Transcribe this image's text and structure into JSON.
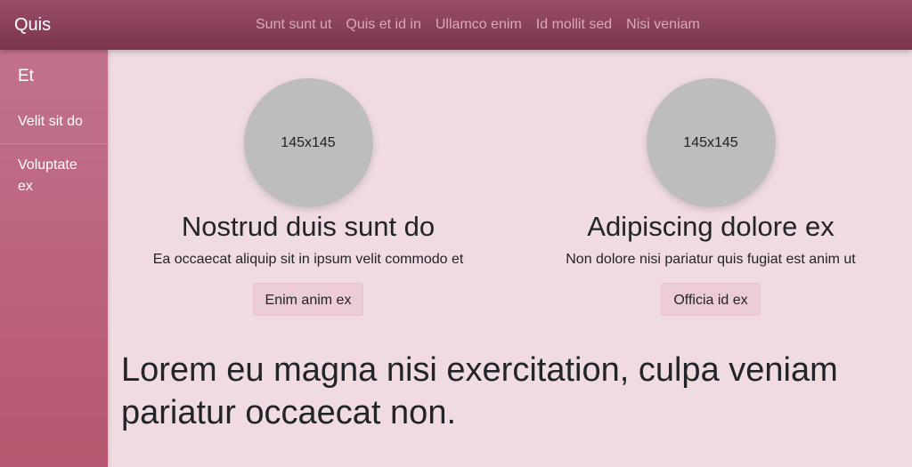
{
  "topbar": {
    "brand": "Quis",
    "nav": [
      "Sunt sunt ut",
      "Quis et id in",
      "Ullamco enim",
      "Id mollit sed",
      "Nisi veniam"
    ]
  },
  "sidebar": {
    "heading": "Et",
    "items": [
      {
        "label": "Velit sit do"
      },
      {
        "label": "Voluptate ex"
      }
    ]
  },
  "cards": [
    {
      "image_placeholder": "145x145",
      "title": "Nostrud duis sunt do",
      "text": "Ea occaecat aliquip sit in ipsum velit commodo et",
      "button": "Enim anim ex"
    },
    {
      "image_placeholder": "145x145",
      "title": "Adipiscing dolore ex",
      "text": "Non dolore nisi pariatur quis fugiat est anim ut",
      "button": "Officia id ex"
    }
  ],
  "headline": "Lorem eu magna nisi exercitation, culpa veniam pariatur occaecat non."
}
